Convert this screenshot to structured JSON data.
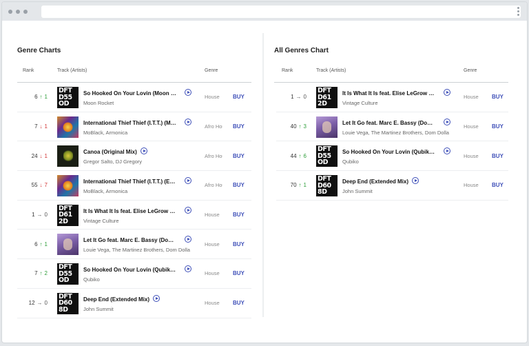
{
  "window": {
    "address": ""
  },
  "left": {
    "title": "Genre Charts",
    "headers": {
      "rank": "Rank",
      "track": "Track (Artists)",
      "genre": "Genre"
    },
    "rows": [
      {
        "rank": "6",
        "dir": "up",
        "delta": "1",
        "title": "So Hooked On Your Lovin (Moon Rocket Remix)",
        "artists": "Moon Rocket",
        "genre": "House",
        "buy": "BUY",
        "art": "dft",
        "art_text": [
          "DFT",
          "D55",
          "OD"
        ]
      },
      {
        "rank": "7",
        "dir": "down",
        "delta": "1",
        "title": "International Thief Thief (I.T.T.) (MoBlack Remix)",
        "artists": "MoBlack, Armonica",
        "genre": "Afro House",
        "buy": "BUY",
        "art": "illu",
        "art_text": []
      },
      {
        "rank": "24",
        "dir": "down",
        "delta": "1",
        "title": "Canoa (Original Mix)",
        "artists": "Gregor Salto, DJ Gregory",
        "genre": "Afro House",
        "buy": "BUY",
        "art": "canoa",
        "art_text": []
      },
      {
        "rank": "55",
        "dir": "down",
        "delta": "7",
        "title": "International Thief Thief (I.T.T.) (Extended Mix)",
        "artists": "MoBlack, Armonica",
        "genre": "Afro House",
        "buy": "BUY",
        "art": "illu",
        "art_text": []
      },
      {
        "rank": "1",
        "dir": "same",
        "delta": "0",
        "title": "It Is What It Is feat. Elise LeGrow (Extended Mix)",
        "artists": "Vintage Culture",
        "genre": "House",
        "buy": "BUY",
        "art": "dft",
        "art_text": [
          "DFT",
          "D61",
          "2D"
        ]
      },
      {
        "rank": "6",
        "dir": "up",
        "delta": "1",
        "title": "Let It Go feat. Marc E. Bassy (Dom Dolla Remix)",
        "artists": "Louie Vega, The Martinez Brothers, Dom Dolla",
        "genre": "House",
        "buy": "BUY",
        "art": "photo",
        "art_text": []
      },
      {
        "rank": "7",
        "dir": "up",
        "delta": "2",
        "title": "So Hooked On Your Lovin (Qubiko Remix)",
        "artists": "Qubiko",
        "genre": "House",
        "buy": "BUY",
        "art": "dft",
        "art_text": [
          "DFT",
          "D55",
          "OD"
        ]
      },
      {
        "rank": "12",
        "dir": "same",
        "delta": "0",
        "title": "Deep End (Extended Mix)",
        "artists": "John Summit",
        "genre": "House",
        "buy": "BUY",
        "art": "dft",
        "art_text": [
          "DFT",
          "D60",
          "8D"
        ]
      }
    ]
  },
  "right": {
    "title": "All Genres Chart",
    "headers": {
      "rank": "Rank",
      "track": "Track (Artists)",
      "genre": "Genre"
    },
    "rows": [
      {
        "rank": "1",
        "dir": "same",
        "delta": "0",
        "title": "It Is What It Is feat. Elise LeGrow (Extended Mix)",
        "artists": "Vintage Culture",
        "genre": "House",
        "buy": "BUY",
        "art": "dft",
        "art_text": [
          "DFT",
          "D61",
          "2D"
        ]
      },
      {
        "rank": "40",
        "dir": "up",
        "delta": "3",
        "title": "Let It Go feat. Marc E. Bassy (Dom Dolla Remix)",
        "artists": "Louie Vega, The Martinez Brothers, Dom Dolla",
        "genre": "House",
        "buy": "BUY",
        "art": "photo",
        "art_text": []
      },
      {
        "rank": "44",
        "dir": "up",
        "delta": "6",
        "title": "So Hooked On Your Lovin (Qubiko Remix)",
        "artists": "Qubiko",
        "genre": "House",
        "buy": "BUY",
        "art": "dft",
        "art_text": [
          "DFT",
          "D55",
          "OD"
        ]
      },
      {
        "rank": "70",
        "dir": "up",
        "delta": "1",
        "title": "Deep End (Extended Mix)",
        "artists": "John Summit",
        "genre": "House",
        "buy": "BUY",
        "art": "dft",
        "art_text": [
          "DFT",
          "D60",
          "8D"
        ]
      }
    ]
  },
  "colors": {
    "accent": "#3e4fb8",
    "up": "#2e9e3a",
    "down": "#d23737"
  },
  "icons": {
    "up": "arrow-up-icon",
    "down": "arrow-down-icon",
    "same": "arrow-right-icon",
    "play": "play-icon"
  }
}
